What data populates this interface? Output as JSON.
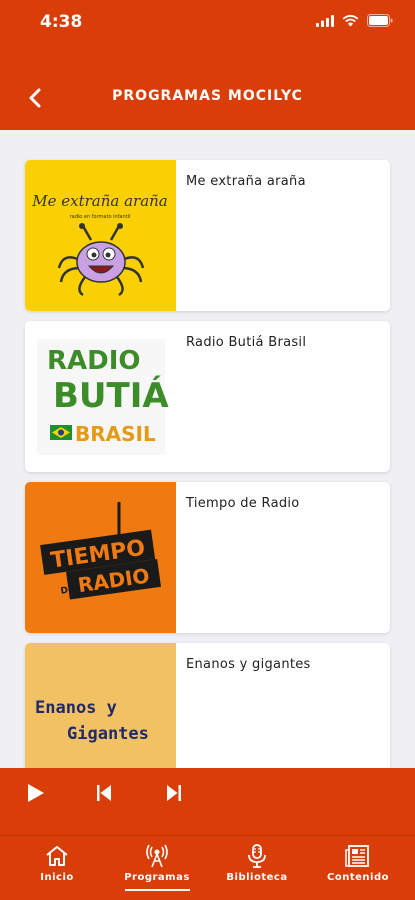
{
  "status_bar": {
    "time": "4:38"
  },
  "header": {
    "title": "PROGRAMAS MOCILYC"
  },
  "programs": [
    {
      "title": "Me extraña araña"
    },
    {
      "title": "Radio Butiá Brasil"
    },
    {
      "title": "Tiempo de Radio"
    },
    {
      "title": "Enanos y gigantes"
    }
  ],
  "logos": {
    "me_extrana": {
      "line1": "Me extraña araña",
      "line2": "radio en formato infantil"
    },
    "butia": {
      "w1": "RADIO",
      "w2": "BUTIÁ",
      "w3": "BRASIL"
    },
    "tiempo": {
      "w1": "TIEMPO",
      "w2": "DE",
      "w3": "RADIO"
    },
    "enanos": {
      "line1": "Enanos y",
      "line2": "Gigantes"
    }
  },
  "tabs": [
    {
      "label": "Inicio"
    },
    {
      "label": "Programas"
    },
    {
      "label": "Biblioteca"
    },
    {
      "label": "Contenido"
    }
  ],
  "colors": {
    "brand": "#d93e08",
    "background": "#f0eff4"
  }
}
